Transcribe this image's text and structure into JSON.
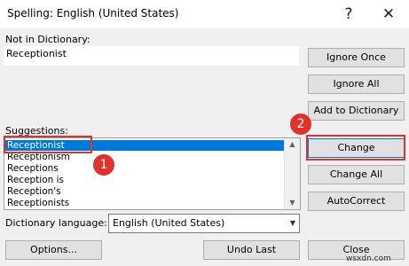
{
  "window": {
    "title": "Spelling: English (United States)",
    "help_glyph": "?",
    "close_glyph": "✕"
  },
  "not_in_dictionary": {
    "label": "Not in Dictionary:",
    "value": "Receptionist"
  },
  "buttons": {
    "ignore_once": "Ignore Once",
    "ignore_all": "Ignore All",
    "add_to_dictionary": "Add to Dictionary",
    "change": "Change",
    "change_all": "Change All",
    "autocorrect": "AutoCorrect",
    "options": "Options...",
    "undo_last": "Undo Last",
    "close": "Close"
  },
  "suggestions": {
    "label": "Suggestions:",
    "items": [
      "Receptionist",
      "Receptionism",
      "Receptions",
      "Reception is",
      "Reception's",
      "Receptionists"
    ],
    "selected_index": 0
  },
  "dictionary_language": {
    "label": "Dictionary language:",
    "value": "English (United States)"
  },
  "annotations": {
    "badge_1": "1",
    "badge_2": "2",
    "color": "#e0312b"
  },
  "watermark": "wsxdn.com"
}
